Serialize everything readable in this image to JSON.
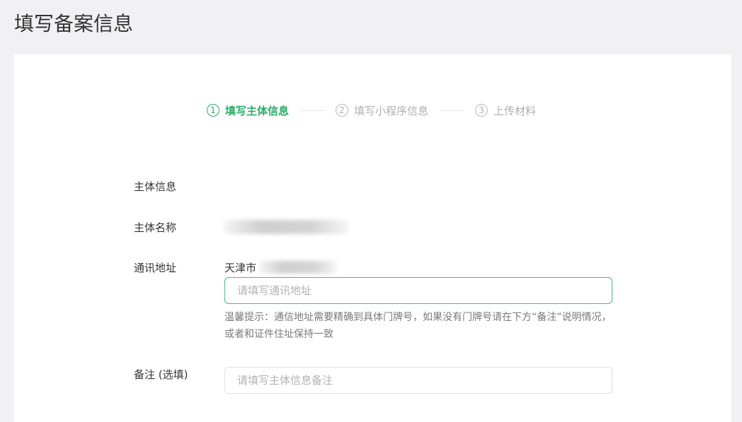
{
  "page": {
    "title": "填写备案信息"
  },
  "steps": [
    {
      "number": "1",
      "label": "填写主体信息",
      "active": true
    },
    {
      "number": "2",
      "label": "填写小程序信息",
      "active": false
    },
    {
      "number": "3",
      "label": "上传材料",
      "active": false
    }
  ],
  "form": {
    "section_title": "主体信息",
    "subject_name_label": "主体名称",
    "address_label": "通讯地址",
    "address_prefix": "天津市",
    "address_placeholder": "请填写通讯地址",
    "address_hint": "温馨提示：通信地址需要精确到具体门牌号，如果没有门牌号请在下方“备注”说明情况，或者和证件住址保持一致",
    "remark_label": "备注 (选填)",
    "remark_placeholder": "请填写主体信息备注"
  },
  "colors": {
    "accent": "#2aae67",
    "focus_border": "#4cbb7d",
    "background": "#f1f1f3"
  }
}
